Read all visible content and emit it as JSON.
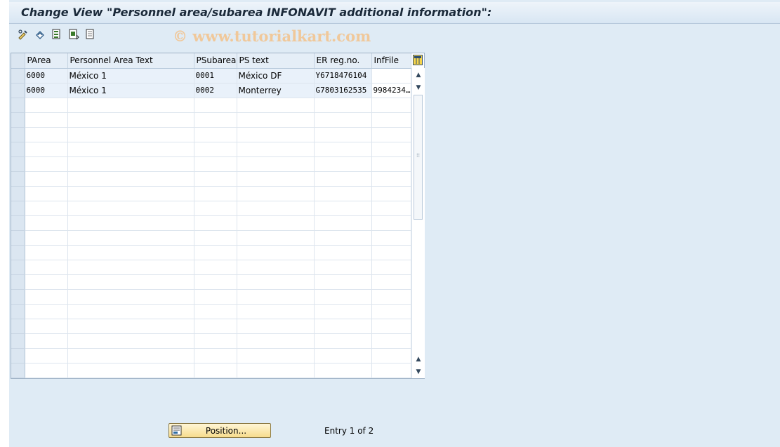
{
  "title": "Change View \"Personnel area/subarea INFONAVIT additional information\":",
  "watermark": "© www.tutorialkart.com",
  "toolbar": {
    "icons": [
      "display-change-icon",
      "undo-icon",
      "select-all-icon",
      "select-block-icon",
      "deselect-all-icon"
    ]
  },
  "table": {
    "columns": [
      "PArea",
      "Personnel Area Text",
      "PSubarea",
      "PS text",
      "ER reg.no.",
      "InfFile"
    ],
    "rows": [
      [
        "6000",
        "México 1",
        "0001",
        "México DF",
        "Y6718476104",
        ""
      ],
      [
        "6000",
        "México 1",
        "0002",
        "Monterrey",
        "G7803162535",
        "9984234…"
      ]
    ],
    "empty_rows": 19
  },
  "position_button_label": "Position...",
  "entry_text": "Entry 1 of 2",
  "colors": {
    "background": "#dfebf5",
    "title_text": "#1b2a3a",
    "watermark": "#f0c89a",
    "button_fill": "#f7dc8d"
  }
}
